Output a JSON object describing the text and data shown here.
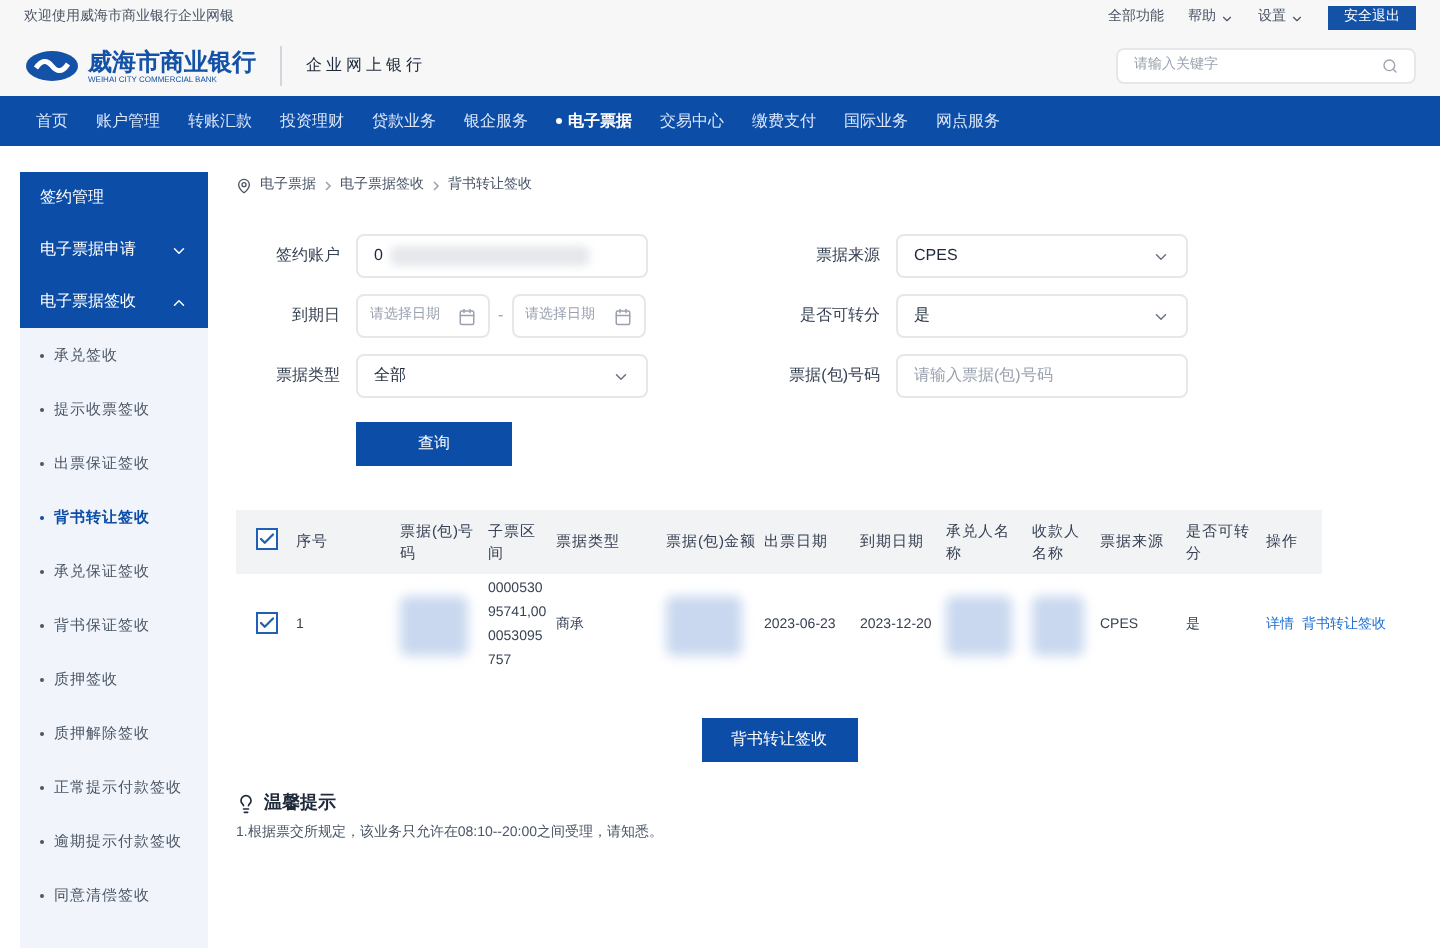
{
  "top_bar": {
    "welcome": "欢迎使用威海市商业银行企业网银",
    "links": [
      {
        "label": "全部功能",
        "dropdown": false
      },
      {
        "label": "帮助",
        "dropdown": true
      },
      {
        "label": "设置",
        "dropdown": true
      }
    ],
    "logout": "安全退出"
  },
  "header": {
    "bank_name": "威海市商业银行",
    "bank_name_en": "WEIHAI CITY COMMERCIAL BANK",
    "product": "企业网上银行",
    "search": {
      "placeholder": "请输入关键字"
    }
  },
  "nav": [
    {
      "label": "首页",
      "selected": false
    },
    {
      "label": "账户管理",
      "selected": false
    },
    {
      "label": "转账汇款",
      "selected": false
    },
    {
      "label": "投资理财",
      "selected": false
    },
    {
      "label": "贷款业务",
      "selected": false
    },
    {
      "label": "银企服务",
      "selected": false
    },
    {
      "label": "电子票据",
      "selected": true
    },
    {
      "label": "交易中心",
      "selected": false
    },
    {
      "label": "缴费支付",
      "selected": false
    },
    {
      "label": "国际业务",
      "selected": false
    },
    {
      "label": "网点服务",
      "selected": false
    }
  ],
  "sidebar": [
    {
      "label": "签约管理"
    },
    {
      "label": "电子票据申请",
      "expanded": false
    },
    {
      "label": "电子票据签收",
      "expanded": true,
      "children": [
        {
          "label": "承兑签收",
          "selected": false
        },
        {
          "label": "提示收票签收",
          "selected": false
        },
        {
          "label": "出票保证签收",
          "selected": false
        },
        {
          "label": "背书转让签收",
          "selected": true
        },
        {
          "label": "承兑保证签收",
          "selected": false
        },
        {
          "label": "背书保证签收",
          "selected": false
        },
        {
          "label": "质押签收",
          "selected": false
        },
        {
          "label": "质押解除签收",
          "selected": false
        },
        {
          "label": "正常提示付款签收",
          "selected": false
        },
        {
          "label": "逾期提示付款签收",
          "selected": false
        },
        {
          "label": "同意清偿签收",
          "selected": false
        }
      ]
    }
  ],
  "breadcrumb": [
    "电子票据",
    "电子票据签收",
    "背书转让签收"
  ],
  "form": {
    "left": [
      {
        "kind": "input",
        "label": "签约账户",
        "value": "0"
      },
      {
        "kind": "date-range",
        "label": "到期日",
        "placeholder_from": "请选择日期",
        "separator": "-",
        "placeholder_to": "请选择日期"
      },
      {
        "kind": "select",
        "label": "票据类型",
        "value": "全部"
      }
    ],
    "right": [
      {
        "kind": "select",
        "label": "票据来源",
        "value": "CPES"
      },
      {
        "kind": "select",
        "label": "是否可转分",
        "value": "是"
      },
      {
        "kind": "input",
        "label": "票据(包)号码",
        "placeholder": "请输入票据(包)号码"
      }
    ],
    "submit": "查询"
  },
  "table": {
    "all_checked": true,
    "columns": [
      "序号",
      "票据(包)号码",
      "子票区间",
      "票据类型",
      "票据(包)金额",
      "出票日期",
      "到期日期",
      "承兑人名称",
      "收款人名称",
      "票据来源",
      "是否可转分",
      "操作"
    ],
    "rows": [
      {
        "checked": true,
        "cells": [
          {
            "kind": "text",
            "text": "1"
          },
          {
            "kind": "blurred"
          },
          {
            "kind": "text",
            "text": "000053095741,000053095757"
          },
          {
            "kind": "text",
            "text": "商承"
          },
          {
            "kind": "blurred"
          },
          {
            "kind": "text",
            "text": "2023-06-23"
          },
          {
            "kind": "text",
            "text": "2023-12-20"
          },
          {
            "kind": "blurred"
          },
          {
            "kind": "blurred"
          },
          {
            "kind": "text",
            "text": "CPES"
          },
          {
            "kind": "text",
            "text": "是"
          },
          {
            "kind": "links",
            "links": [
              "详情",
              "背书转让签收"
            ]
          }
        ]
      }
    ]
  },
  "action_button": "背书转让签收",
  "tips": {
    "title": "温馨提示",
    "lines": [
      "1.根据票交所规定，该业务只允许在08:10--20:00之间受理，请知悉。"
    ]
  }
}
